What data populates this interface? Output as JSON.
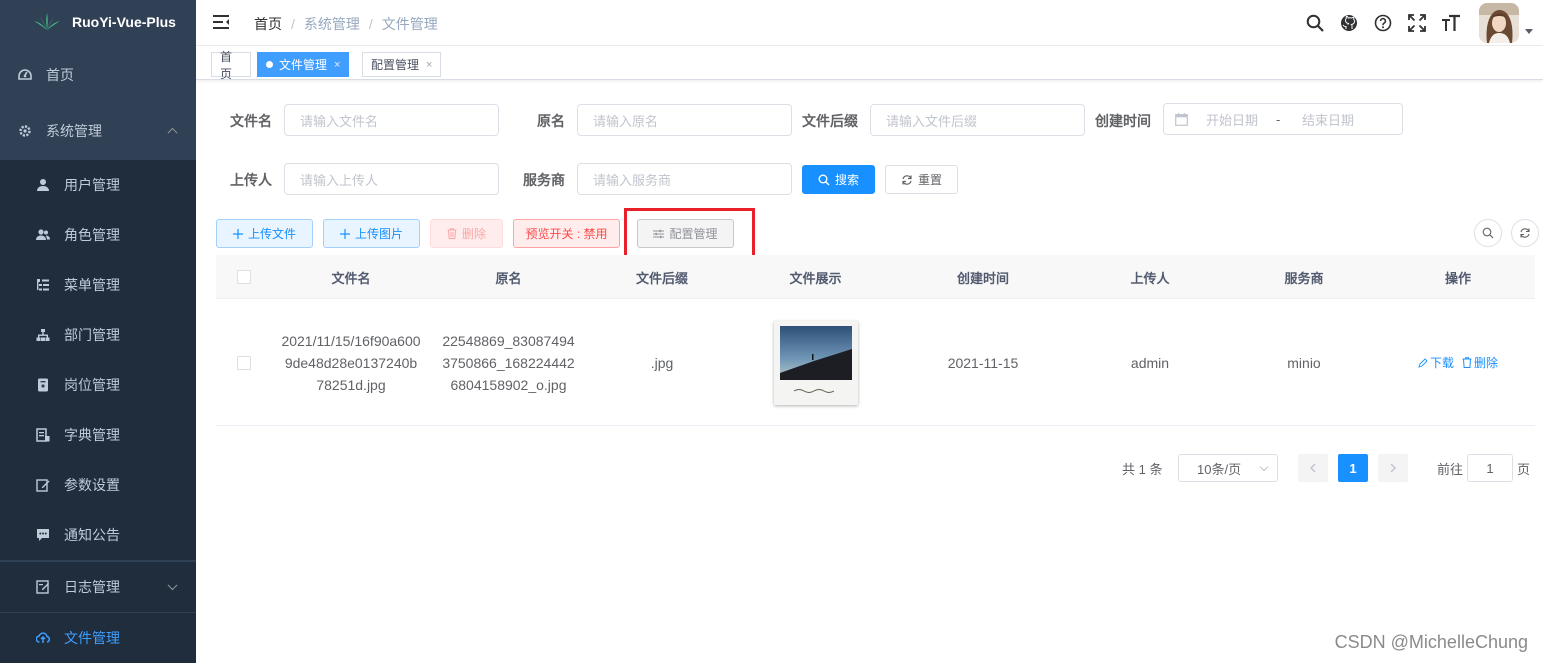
{
  "app": {
    "title": "RuoYi-Vue-Plus"
  },
  "sidebar": {
    "items": [
      {
        "label": "首页",
        "icon": "dashboard-icon"
      },
      {
        "label": "系统管理",
        "icon": "gear-icon"
      },
      {
        "label": "用户管理",
        "icon": "user-icon"
      },
      {
        "label": "角色管理",
        "icon": "peoples-icon"
      },
      {
        "label": "菜单管理",
        "icon": "tree-table-icon"
      },
      {
        "label": "部门管理",
        "icon": "tree-icon"
      },
      {
        "label": "岗位管理",
        "icon": "post-icon"
      },
      {
        "label": "字典管理",
        "icon": "dict-icon"
      },
      {
        "label": "参数设置",
        "icon": "edit-icon"
      },
      {
        "label": "通知公告",
        "icon": "message-icon"
      },
      {
        "label": "日志管理",
        "icon": "log-icon"
      },
      {
        "label": "文件管理",
        "icon": "upload-icon"
      }
    ]
  },
  "breadcrumb": {
    "home": "首页",
    "level1": "系统管理",
    "current": "文件管理"
  },
  "tags": [
    {
      "label": "首页"
    },
    {
      "label": "文件管理"
    },
    {
      "label": "配置管理"
    }
  ],
  "search": {
    "file_name_label": "文件名",
    "file_name_placeholder": "请输入文件名",
    "original_label": "原名",
    "original_placeholder": "请输入原名",
    "suffix_label": "文件后缀",
    "suffix_placeholder": "请输入文件后缀",
    "created_label": "创建时间",
    "start_placeholder": "开始日期",
    "range_sep": "-",
    "end_placeholder": "结束日期",
    "uploader_label": "上传人",
    "uploader_placeholder": "请输入上传人",
    "service_label": "服务商",
    "service_placeholder": "请输入服务商",
    "search_btn": "搜索",
    "reset_btn": "重置"
  },
  "toolbar": {
    "upload_file": "上传文件",
    "upload_image": "上传图片",
    "delete": "删除",
    "preview_switch": "预览开关 : 禁用",
    "config": "配置管理"
  },
  "table": {
    "headers": [
      "文件名",
      "原名",
      "文件后缀",
      "文件展示",
      "创建时间",
      "上传人",
      "服务商",
      "操作"
    ],
    "rows": [
      {
        "file_name": "2021/11/15/16f90a6009de48d28e0137240b78251d.jpg",
        "file_name_lines": [
          "2021/11/15/16f90a600",
          "9de48d28e0137240b",
          "78251d.jpg"
        ],
        "original_lines": [
          "22548869_83087494",
          "3750866_168224442",
          "6804158902_o.jpg"
        ],
        "suffix": ".jpg",
        "created": "2021-11-15",
        "uploader": "admin",
        "service": "minio",
        "download": "下载",
        "delete": "删除"
      }
    ]
  },
  "pagination": {
    "total_text": "共 1 条",
    "page_size": "10条/页",
    "current_page": "1",
    "goto_prefix": "前往",
    "goto_value": "1",
    "goto_suffix": "页"
  },
  "watermark": "CSDN @MichelleChung",
  "colors": {
    "primary": "#1890ff",
    "sidebar_bg": "#304156",
    "highlight": "#e8202a"
  }
}
